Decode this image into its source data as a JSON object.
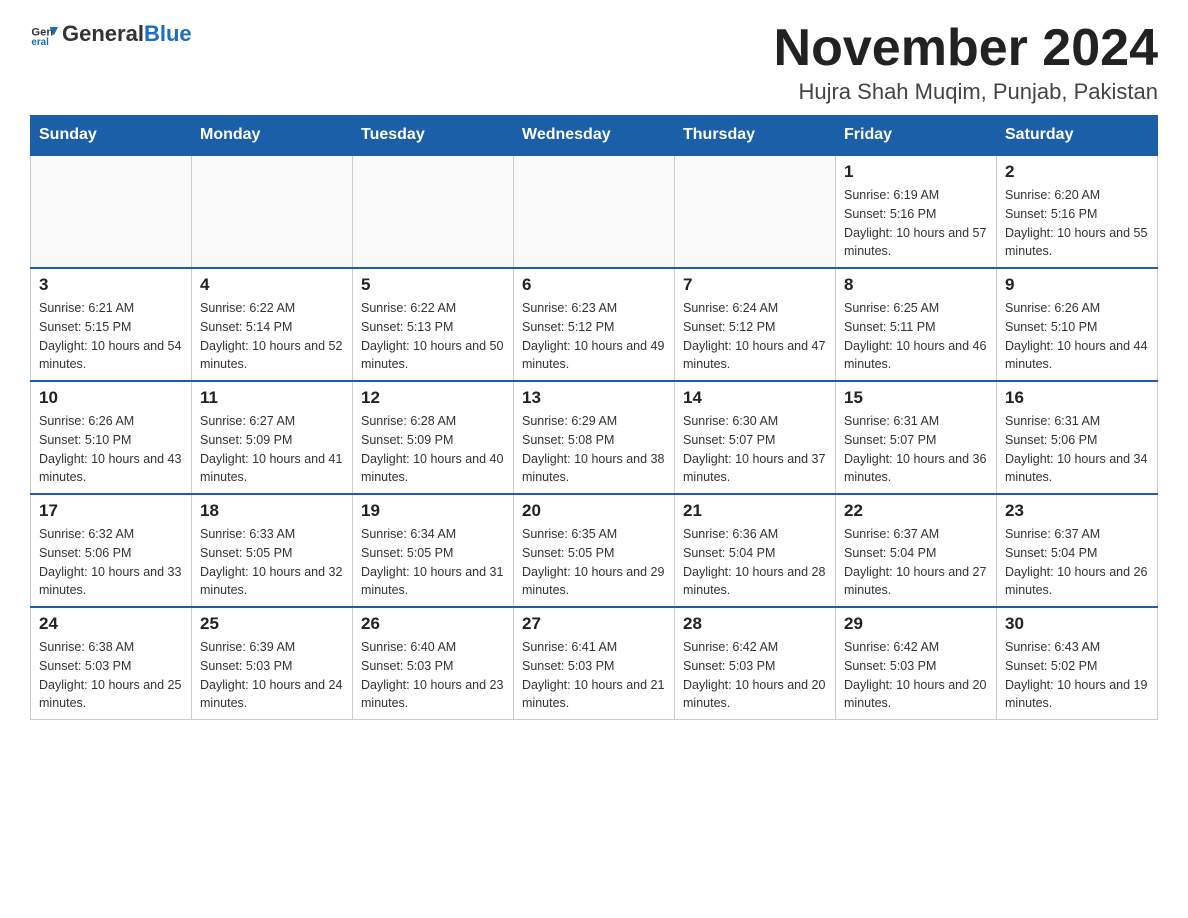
{
  "header": {
    "logo_general": "General",
    "logo_blue": "Blue",
    "month_title": "November 2024",
    "location": "Hujra Shah Muqim, Punjab, Pakistan"
  },
  "weekdays": [
    "Sunday",
    "Monday",
    "Tuesday",
    "Wednesday",
    "Thursday",
    "Friday",
    "Saturday"
  ],
  "weeks": [
    [
      {
        "day": "",
        "sunrise": "",
        "sunset": "",
        "daylight": ""
      },
      {
        "day": "",
        "sunrise": "",
        "sunset": "",
        "daylight": ""
      },
      {
        "day": "",
        "sunrise": "",
        "sunset": "",
        "daylight": ""
      },
      {
        "day": "",
        "sunrise": "",
        "sunset": "",
        "daylight": ""
      },
      {
        "day": "",
        "sunrise": "",
        "sunset": "",
        "daylight": ""
      },
      {
        "day": "1",
        "sunrise": "Sunrise: 6:19 AM",
        "sunset": "Sunset: 5:16 PM",
        "daylight": "Daylight: 10 hours and 57 minutes."
      },
      {
        "day": "2",
        "sunrise": "Sunrise: 6:20 AM",
        "sunset": "Sunset: 5:16 PM",
        "daylight": "Daylight: 10 hours and 55 minutes."
      }
    ],
    [
      {
        "day": "3",
        "sunrise": "Sunrise: 6:21 AM",
        "sunset": "Sunset: 5:15 PM",
        "daylight": "Daylight: 10 hours and 54 minutes."
      },
      {
        "day": "4",
        "sunrise": "Sunrise: 6:22 AM",
        "sunset": "Sunset: 5:14 PM",
        "daylight": "Daylight: 10 hours and 52 minutes."
      },
      {
        "day": "5",
        "sunrise": "Sunrise: 6:22 AM",
        "sunset": "Sunset: 5:13 PM",
        "daylight": "Daylight: 10 hours and 50 minutes."
      },
      {
        "day": "6",
        "sunrise": "Sunrise: 6:23 AM",
        "sunset": "Sunset: 5:12 PM",
        "daylight": "Daylight: 10 hours and 49 minutes."
      },
      {
        "day": "7",
        "sunrise": "Sunrise: 6:24 AM",
        "sunset": "Sunset: 5:12 PM",
        "daylight": "Daylight: 10 hours and 47 minutes."
      },
      {
        "day": "8",
        "sunrise": "Sunrise: 6:25 AM",
        "sunset": "Sunset: 5:11 PM",
        "daylight": "Daylight: 10 hours and 46 minutes."
      },
      {
        "day": "9",
        "sunrise": "Sunrise: 6:26 AM",
        "sunset": "Sunset: 5:10 PM",
        "daylight": "Daylight: 10 hours and 44 minutes."
      }
    ],
    [
      {
        "day": "10",
        "sunrise": "Sunrise: 6:26 AM",
        "sunset": "Sunset: 5:10 PM",
        "daylight": "Daylight: 10 hours and 43 minutes."
      },
      {
        "day": "11",
        "sunrise": "Sunrise: 6:27 AM",
        "sunset": "Sunset: 5:09 PM",
        "daylight": "Daylight: 10 hours and 41 minutes."
      },
      {
        "day": "12",
        "sunrise": "Sunrise: 6:28 AM",
        "sunset": "Sunset: 5:09 PM",
        "daylight": "Daylight: 10 hours and 40 minutes."
      },
      {
        "day": "13",
        "sunrise": "Sunrise: 6:29 AM",
        "sunset": "Sunset: 5:08 PM",
        "daylight": "Daylight: 10 hours and 38 minutes."
      },
      {
        "day": "14",
        "sunrise": "Sunrise: 6:30 AM",
        "sunset": "Sunset: 5:07 PM",
        "daylight": "Daylight: 10 hours and 37 minutes."
      },
      {
        "day": "15",
        "sunrise": "Sunrise: 6:31 AM",
        "sunset": "Sunset: 5:07 PM",
        "daylight": "Daylight: 10 hours and 36 minutes."
      },
      {
        "day": "16",
        "sunrise": "Sunrise: 6:31 AM",
        "sunset": "Sunset: 5:06 PM",
        "daylight": "Daylight: 10 hours and 34 minutes."
      }
    ],
    [
      {
        "day": "17",
        "sunrise": "Sunrise: 6:32 AM",
        "sunset": "Sunset: 5:06 PM",
        "daylight": "Daylight: 10 hours and 33 minutes."
      },
      {
        "day": "18",
        "sunrise": "Sunrise: 6:33 AM",
        "sunset": "Sunset: 5:05 PM",
        "daylight": "Daylight: 10 hours and 32 minutes."
      },
      {
        "day": "19",
        "sunrise": "Sunrise: 6:34 AM",
        "sunset": "Sunset: 5:05 PM",
        "daylight": "Daylight: 10 hours and 31 minutes."
      },
      {
        "day": "20",
        "sunrise": "Sunrise: 6:35 AM",
        "sunset": "Sunset: 5:05 PM",
        "daylight": "Daylight: 10 hours and 29 minutes."
      },
      {
        "day": "21",
        "sunrise": "Sunrise: 6:36 AM",
        "sunset": "Sunset: 5:04 PM",
        "daylight": "Daylight: 10 hours and 28 minutes."
      },
      {
        "day": "22",
        "sunrise": "Sunrise: 6:37 AM",
        "sunset": "Sunset: 5:04 PM",
        "daylight": "Daylight: 10 hours and 27 minutes."
      },
      {
        "day": "23",
        "sunrise": "Sunrise: 6:37 AM",
        "sunset": "Sunset: 5:04 PM",
        "daylight": "Daylight: 10 hours and 26 minutes."
      }
    ],
    [
      {
        "day": "24",
        "sunrise": "Sunrise: 6:38 AM",
        "sunset": "Sunset: 5:03 PM",
        "daylight": "Daylight: 10 hours and 25 minutes."
      },
      {
        "day": "25",
        "sunrise": "Sunrise: 6:39 AM",
        "sunset": "Sunset: 5:03 PM",
        "daylight": "Daylight: 10 hours and 24 minutes."
      },
      {
        "day": "26",
        "sunrise": "Sunrise: 6:40 AM",
        "sunset": "Sunset: 5:03 PM",
        "daylight": "Daylight: 10 hours and 23 minutes."
      },
      {
        "day": "27",
        "sunrise": "Sunrise: 6:41 AM",
        "sunset": "Sunset: 5:03 PM",
        "daylight": "Daylight: 10 hours and 21 minutes."
      },
      {
        "day": "28",
        "sunrise": "Sunrise: 6:42 AM",
        "sunset": "Sunset: 5:03 PM",
        "daylight": "Daylight: 10 hours and 20 minutes."
      },
      {
        "day": "29",
        "sunrise": "Sunrise: 6:42 AM",
        "sunset": "Sunset: 5:03 PM",
        "daylight": "Daylight: 10 hours and 20 minutes."
      },
      {
        "day": "30",
        "sunrise": "Sunrise: 6:43 AM",
        "sunset": "Sunset: 5:02 PM",
        "daylight": "Daylight: 10 hours and 19 minutes."
      }
    ]
  ]
}
